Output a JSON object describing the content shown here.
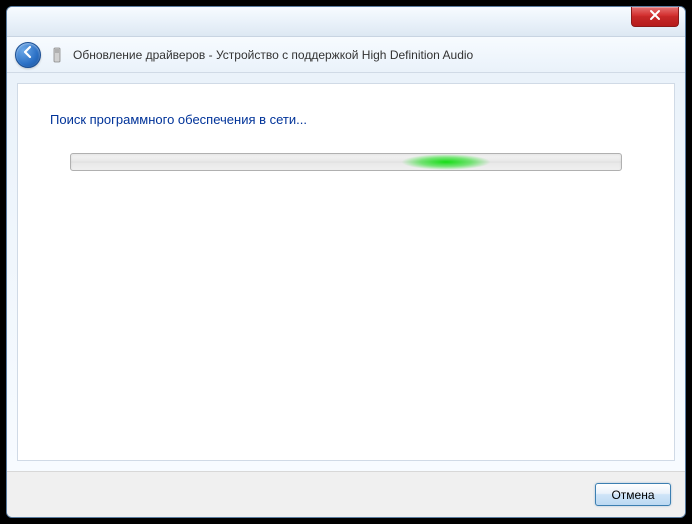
{
  "window": {
    "title": "Обновление драйверов - Устройство с поддержкой High Definition Audio"
  },
  "content": {
    "heading": "Поиск программного обеспечения в сети..."
  },
  "footer": {
    "cancel_label": "Отмена"
  }
}
